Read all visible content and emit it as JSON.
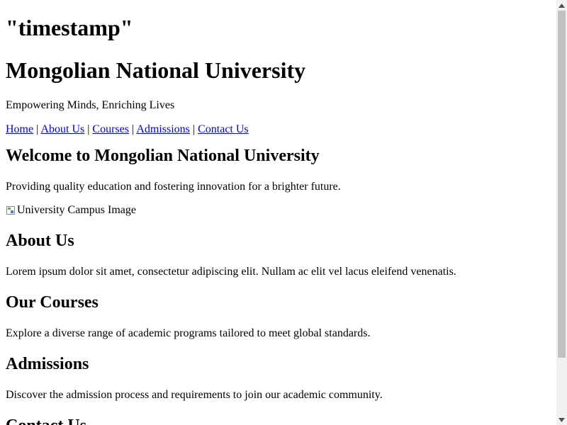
{
  "timestamp_heading": "\"timestamp\"",
  "header": {
    "title": "Mongolian National University",
    "tagline": "Empowering Minds, Enriching Lives"
  },
  "nav": {
    "separator": "|",
    "items": [
      {
        "label": "Home"
      },
      {
        "label": "About Us"
      },
      {
        "label": "Courses"
      },
      {
        "label": "Admissions"
      },
      {
        "label": "Contact Us"
      }
    ]
  },
  "welcome": {
    "heading": "Welcome to Mongolian National University",
    "text": "Providing quality education and fostering innovation for a brighter future.",
    "image_alt": "University Campus Image"
  },
  "about": {
    "heading": "About Us",
    "text": "Lorem ipsum dolor sit amet, consectetur adipiscing elit. Nullam ac elit vel lacus eleifend venenatis."
  },
  "courses": {
    "heading": "Our Courses",
    "text": "Explore a diverse range of academic programs tailored to meet global standards."
  },
  "admissions": {
    "heading": "Admissions",
    "text": "Discover the admission process and requirements to join our academic community."
  },
  "contact": {
    "heading": "Contact Us"
  },
  "colors": {
    "link": "#0000ee",
    "text": "#000000",
    "background": "#ffffff",
    "scrollbar_track": "#f1f1f1",
    "scrollbar_thumb": "#c1c1c1"
  }
}
